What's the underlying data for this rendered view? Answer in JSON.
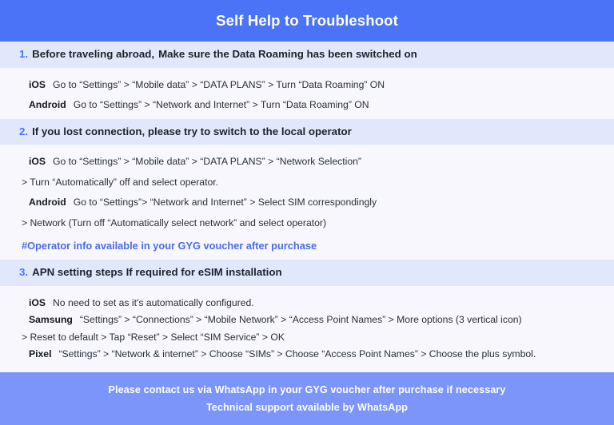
{
  "header": {
    "title": "Self Help to Troubleshoot",
    "bg_color": "#4a73f8",
    "text_color": "#ffffff"
  },
  "theme": {
    "page_bg": "#f7f7fd",
    "section_head_bg": "#e1e8fc",
    "accent_blue": "#4a73f8",
    "highlight_blue": "#4a6ce8",
    "footer_bg": "#7b95fb"
  },
  "sections": [
    {
      "number": "1.",
      "head_lead": "Before traveling abroad,",
      "head_rest": "Make sure the Data Roaming has been switched on",
      "lines": [
        {
          "platform": "iOS",
          "text": "Go to “Settings” > “Mobile data” > “DATA PLANS” > Turn “Data Roaming” ON"
        },
        {
          "platform": "Android",
          "text": "Go to “Settings” > “Network and Internet” > Turn “Data Roaming” ON"
        }
      ]
    },
    {
      "number": "2.",
      "head_lead": "If you lost connection, please try to switch to the local operator",
      "head_rest": "",
      "lines": [
        {
          "platform": "iOS",
          "text": "Go to “Settings” > “Mobile data” > “DATA PLANS” > “Network Selection”"
        },
        {
          "platform": "",
          "text": "> Turn “Automatically” off and select operator."
        },
        {
          "platform": "Android",
          "text": "Go to “Settings”>  “Network and Internet” > Select SIM correspondingly"
        },
        {
          "platform": "",
          "text": "> Network (Turn off “Automatically select network” and select operator)"
        }
      ],
      "highlight": "#Operator info available in your GYG voucher after purchase"
    },
    {
      "number": "3.",
      "head_lead": "APN setting steps If required for eSIM installation",
      "head_rest": "",
      "lines": [
        {
          "platform": "iOS",
          "text": "No need to set as it's automatically configured."
        },
        {
          "platform": "Samsung",
          "text": "“Settings” > “Connections” > “Mobile Network” > “Access Point Names” > More options (3 vertical icon)"
        },
        {
          "platform": "",
          "text": "> Reset to default > Tap “Reset” > Select “SIM Service” > OK"
        },
        {
          "platform": "Pixel",
          "text": "“Settings” > “Network & internet” > Choose “SIMs” > Choose “Access Point Names” > Choose the plus symbol."
        }
      ]
    }
  ],
  "footer": {
    "line1": "Please contact us via WhatsApp  in your GYG voucher after purchase if necessary",
    "line2": "Technical support available by WhatsApp"
  }
}
